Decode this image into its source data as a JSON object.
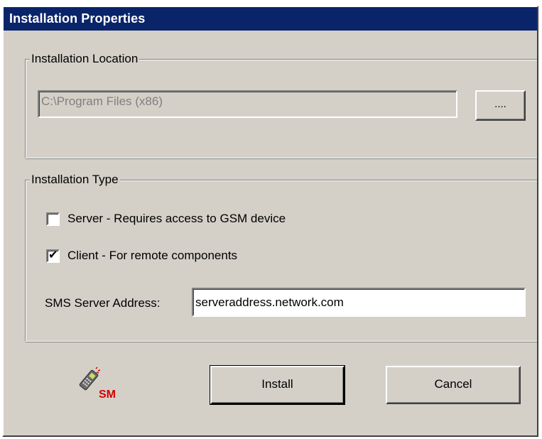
{
  "window": {
    "title": "Installation Properties"
  },
  "location_group": {
    "legend": "Installation Location",
    "path_value": "C:\\Program Files (x86)",
    "browse_label": "...."
  },
  "type_group": {
    "legend": "Installation Type",
    "server_option": {
      "label": "Server - Requires access to GSM device",
      "checked": false
    },
    "client_option": {
      "label": "Client - For remote components",
      "checked": true
    },
    "server_address_label": "SMS Server Address:",
    "server_address_value": "serveraddress.network.com"
  },
  "footer": {
    "logo_text": "SM",
    "install_label": "Install",
    "cancel_label": "Cancel"
  },
  "colors": {
    "titlebar": "#0a246a",
    "dialog_face": "#d4d0c8",
    "logo_red": "#d40000"
  },
  "icons": {
    "logo": "sms-device-icon"
  }
}
